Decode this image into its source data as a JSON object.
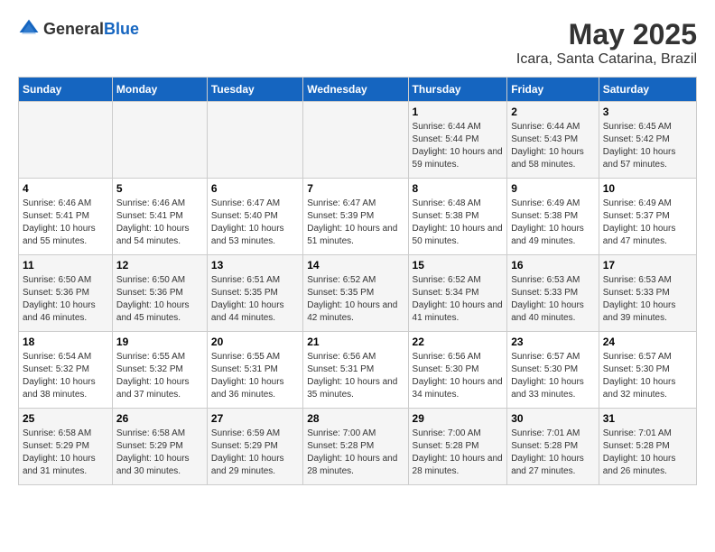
{
  "logo": {
    "general": "General",
    "blue": "Blue"
  },
  "title": "May 2025",
  "subtitle": "Icara, Santa Catarina, Brazil",
  "days_header": [
    "Sunday",
    "Monday",
    "Tuesday",
    "Wednesday",
    "Thursday",
    "Friday",
    "Saturday"
  ],
  "weeks": [
    {
      "days": [
        {
          "num": "",
          "info": ""
        },
        {
          "num": "",
          "info": ""
        },
        {
          "num": "",
          "info": ""
        },
        {
          "num": "",
          "info": ""
        },
        {
          "num": "1",
          "info": "Sunrise: 6:44 AM\nSunset: 5:44 PM\nDaylight: 10 hours and 59 minutes."
        },
        {
          "num": "2",
          "info": "Sunrise: 6:44 AM\nSunset: 5:43 PM\nDaylight: 10 hours and 58 minutes."
        },
        {
          "num": "3",
          "info": "Sunrise: 6:45 AM\nSunset: 5:42 PM\nDaylight: 10 hours and 57 minutes."
        }
      ]
    },
    {
      "days": [
        {
          "num": "4",
          "info": "Sunrise: 6:46 AM\nSunset: 5:41 PM\nDaylight: 10 hours and 55 minutes."
        },
        {
          "num": "5",
          "info": "Sunrise: 6:46 AM\nSunset: 5:41 PM\nDaylight: 10 hours and 54 minutes."
        },
        {
          "num": "6",
          "info": "Sunrise: 6:47 AM\nSunset: 5:40 PM\nDaylight: 10 hours and 53 minutes."
        },
        {
          "num": "7",
          "info": "Sunrise: 6:47 AM\nSunset: 5:39 PM\nDaylight: 10 hours and 51 minutes."
        },
        {
          "num": "8",
          "info": "Sunrise: 6:48 AM\nSunset: 5:38 PM\nDaylight: 10 hours and 50 minutes."
        },
        {
          "num": "9",
          "info": "Sunrise: 6:49 AM\nSunset: 5:38 PM\nDaylight: 10 hours and 49 minutes."
        },
        {
          "num": "10",
          "info": "Sunrise: 6:49 AM\nSunset: 5:37 PM\nDaylight: 10 hours and 47 minutes."
        }
      ]
    },
    {
      "days": [
        {
          "num": "11",
          "info": "Sunrise: 6:50 AM\nSunset: 5:36 PM\nDaylight: 10 hours and 46 minutes."
        },
        {
          "num": "12",
          "info": "Sunrise: 6:50 AM\nSunset: 5:36 PM\nDaylight: 10 hours and 45 minutes."
        },
        {
          "num": "13",
          "info": "Sunrise: 6:51 AM\nSunset: 5:35 PM\nDaylight: 10 hours and 44 minutes."
        },
        {
          "num": "14",
          "info": "Sunrise: 6:52 AM\nSunset: 5:35 PM\nDaylight: 10 hours and 42 minutes."
        },
        {
          "num": "15",
          "info": "Sunrise: 6:52 AM\nSunset: 5:34 PM\nDaylight: 10 hours and 41 minutes."
        },
        {
          "num": "16",
          "info": "Sunrise: 6:53 AM\nSunset: 5:33 PM\nDaylight: 10 hours and 40 minutes."
        },
        {
          "num": "17",
          "info": "Sunrise: 6:53 AM\nSunset: 5:33 PM\nDaylight: 10 hours and 39 minutes."
        }
      ]
    },
    {
      "days": [
        {
          "num": "18",
          "info": "Sunrise: 6:54 AM\nSunset: 5:32 PM\nDaylight: 10 hours and 38 minutes."
        },
        {
          "num": "19",
          "info": "Sunrise: 6:55 AM\nSunset: 5:32 PM\nDaylight: 10 hours and 37 minutes."
        },
        {
          "num": "20",
          "info": "Sunrise: 6:55 AM\nSunset: 5:31 PM\nDaylight: 10 hours and 36 minutes."
        },
        {
          "num": "21",
          "info": "Sunrise: 6:56 AM\nSunset: 5:31 PM\nDaylight: 10 hours and 35 minutes."
        },
        {
          "num": "22",
          "info": "Sunrise: 6:56 AM\nSunset: 5:30 PM\nDaylight: 10 hours and 34 minutes."
        },
        {
          "num": "23",
          "info": "Sunrise: 6:57 AM\nSunset: 5:30 PM\nDaylight: 10 hours and 33 minutes."
        },
        {
          "num": "24",
          "info": "Sunrise: 6:57 AM\nSunset: 5:30 PM\nDaylight: 10 hours and 32 minutes."
        }
      ]
    },
    {
      "days": [
        {
          "num": "25",
          "info": "Sunrise: 6:58 AM\nSunset: 5:29 PM\nDaylight: 10 hours and 31 minutes."
        },
        {
          "num": "26",
          "info": "Sunrise: 6:58 AM\nSunset: 5:29 PM\nDaylight: 10 hours and 30 minutes."
        },
        {
          "num": "27",
          "info": "Sunrise: 6:59 AM\nSunset: 5:29 PM\nDaylight: 10 hours and 29 minutes."
        },
        {
          "num": "28",
          "info": "Sunrise: 7:00 AM\nSunset: 5:28 PM\nDaylight: 10 hours and 28 minutes."
        },
        {
          "num": "29",
          "info": "Sunrise: 7:00 AM\nSunset: 5:28 PM\nDaylight: 10 hours and 28 minutes."
        },
        {
          "num": "30",
          "info": "Sunrise: 7:01 AM\nSunset: 5:28 PM\nDaylight: 10 hours and 27 minutes."
        },
        {
          "num": "31",
          "info": "Sunrise: 7:01 AM\nSunset: 5:28 PM\nDaylight: 10 hours and 26 minutes."
        }
      ]
    }
  ]
}
